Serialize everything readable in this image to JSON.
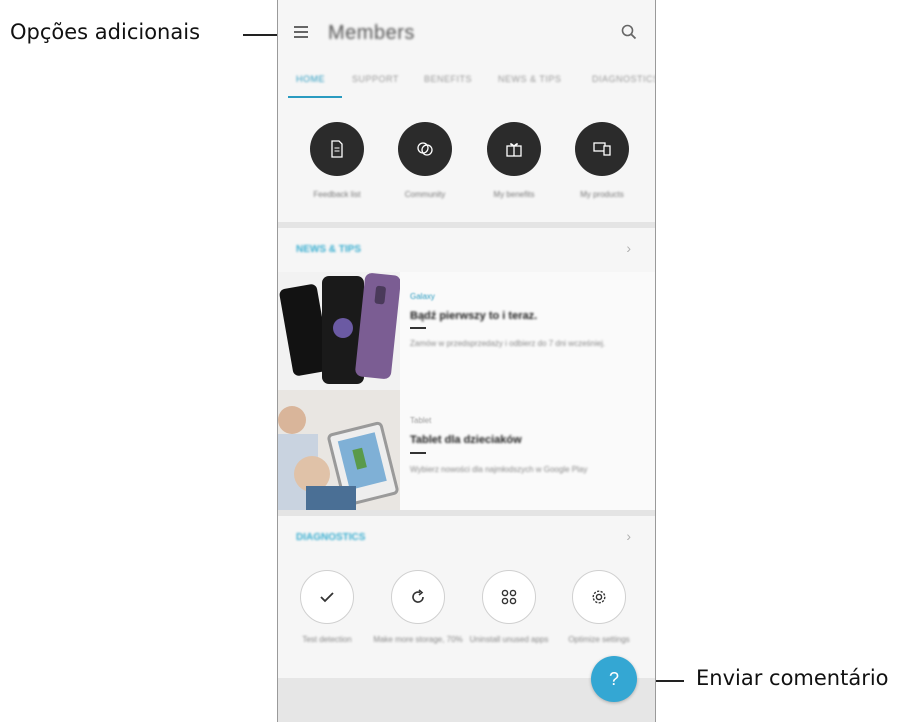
{
  "callouts": {
    "left_label": "Opções adicionais",
    "right_label": "Enviar comentário"
  },
  "app": {
    "title": "Members",
    "tabs": [
      "HOME",
      "SUPPORT",
      "BENEFITS",
      "NEWS & TIPS",
      "DIAGNOSTICS"
    ],
    "active_tab": "HOME",
    "accent_color": "#34a7d3"
  },
  "quick_actions": [
    {
      "label": "Feedback list",
      "icon": "document-icon"
    },
    {
      "label": "Community",
      "icon": "community-icon"
    },
    {
      "label": "My benefits",
      "icon": "gift-icon"
    },
    {
      "label": "My products",
      "icon": "devices-icon"
    }
  ],
  "news_section": {
    "title": "NEWS & TIPS",
    "cards": [
      {
        "category": "Galaxy",
        "title": "Bądź pierwszy to i teraz.",
        "desc": "Zamów w przedsprzedaży i odbierz do 7 dni wcześniej."
      },
      {
        "category": "Tablet",
        "title": "Tablet dla dzieciaków",
        "desc": "Wybierz nowości dla najmłodszych w Google Play"
      }
    ]
  },
  "diagnostics_section": {
    "title": "DIAGNOSTICS",
    "items": [
      {
        "label": "Test detection",
        "icon": "check-icon"
      },
      {
        "label": "Make more storage, 70%",
        "icon": "refresh-icon"
      },
      {
        "label": "Uninstall unused apps",
        "icon": "apps-grid-icon"
      },
      {
        "label": "Optimize settings",
        "icon": "settings-icon"
      }
    ]
  },
  "fab": {
    "label": "?"
  }
}
